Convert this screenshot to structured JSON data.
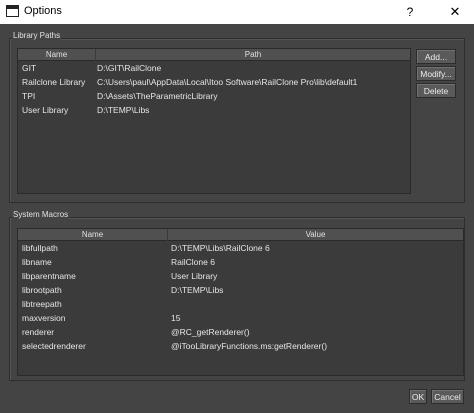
{
  "window": {
    "title": "Options",
    "help_glyph": "?",
    "close_glyph": "✕"
  },
  "library_paths": {
    "group_title": "Library Paths",
    "headers": {
      "name": "Name",
      "path": "Path"
    },
    "rows": [
      {
        "name": "GIT",
        "path": "D:\\GIT\\RailClone"
      },
      {
        "name": "Railclone Library",
        "path": "C:\\Users\\paul\\AppData\\Local\\Itoo Software\\RailClone Pro\\lib\\default1"
      },
      {
        "name": "TPI",
        "path": "D:\\Assets\\TheParametricLibrary"
      },
      {
        "name": "User Library",
        "path": "D:\\TEMP\\Libs"
      }
    ],
    "buttons": {
      "add": "Add...",
      "modify": "Modify...",
      "delete": "Delete"
    }
  },
  "system_macros": {
    "group_title": "System Macros",
    "headers": {
      "name": "Name",
      "value": "Value"
    },
    "rows": [
      {
        "name": "libfullpath",
        "value": "D:\\TEMP\\Libs\\RailClone 6"
      },
      {
        "name": "libname",
        "value": "RailClone 6"
      },
      {
        "name": "libparentname",
        "value": "User Library"
      },
      {
        "name": "librootpath",
        "value": "D:\\TEMP\\Libs"
      },
      {
        "name": "libtreepath",
        "value": ""
      },
      {
        "name": "maxversion",
        "value": "15"
      },
      {
        "name": "renderer",
        "value": "@RC_getRenderer()"
      },
      {
        "name": "selectedrenderer",
        "value": "@iTooLibraryFunctions.ms:getRenderer()"
      }
    ]
  },
  "footer": {
    "ok": "OK",
    "cancel": "Cancel"
  }
}
